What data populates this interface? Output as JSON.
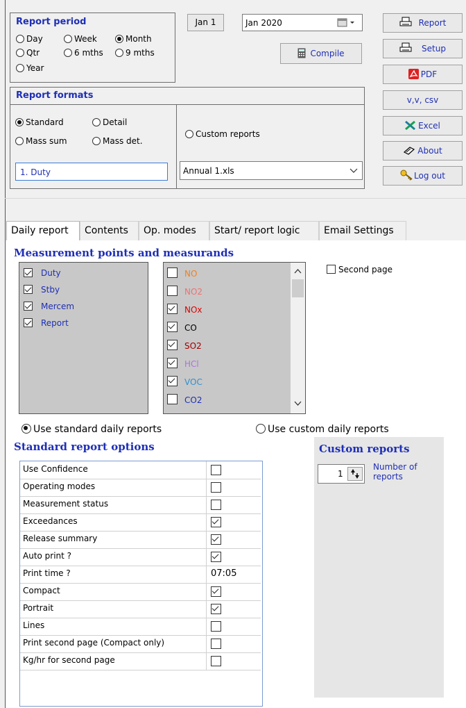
{
  "report_period": {
    "title": "Report period",
    "options": [
      {
        "label": "Day",
        "selected": false
      },
      {
        "label": "Week",
        "selected": false
      },
      {
        "label": "Month",
        "selected": true
      },
      {
        "label": "Qtr",
        "selected": false
      },
      {
        "label": "6 mths",
        "selected": false
      },
      {
        "label": "9 mths",
        "selected": false
      },
      {
        "label": "Year",
        "selected": false
      }
    ]
  },
  "date": {
    "jan1_label": "Jan 1",
    "month_value": "Jan 2020",
    "compile_label": "Compile"
  },
  "right_buttons": {
    "report": "Report",
    "setup": "Setup",
    "pdf": "PDF",
    "csv": "v,v, csv",
    "excel": "Excel",
    "about": "About",
    "logout": "Log out"
  },
  "report_formats": {
    "title": "Report formats",
    "options": [
      {
        "label": "Standard",
        "selected": true
      },
      {
        "label": "Detail",
        "selected": false
      },
      {
        "label": "Mass sum",
        "selected": false
      },
      {
        "label": "Mass det.",
        "selected": false
      }
    ],
    "custom_reports_label": "Custom reports",
    "duty_value": "1. Duty",
    "custom_file": "Annual 1.xls"
  },
  "tabs": [
    {
      "label": "Daily report",
      "active": true
    },
    {
      "label": "Contents",
      "active": false
    },
    {
      "label": "Op. modes",
      "active": false
    },
    {
      "label": "Start/ report logic",
      "active": false
    },
    {
      "label": "Email Settings",
      "active": false
    }
  ],
  "measurement": {
    "title": "Measurement points and measurands",
    "points": [
      {
        "label": "Duty",
        "checked": true
      },
      {
        "label": "Stby",
        "checked": true
      },
      {
        "label": "Mercem",
        "checked": true
      },
      {
        "label": "Report",
        "checked": true
      }
    ],
    "measurands": [
      {
        "label": "NO",
        "checked": false,
        "color": "#f08020"
      },
      {
        "label": "NO2",
        "checked": false,
        "color": "#f07070"
      },
      {
        "label": "NOx",
        "checked": true,
        "color": "#e00000"
      },
      {
        "label": "CO",
        "checked": true,
        "color": "#000000"
      },
      {
        "label": "SO2",
        "checked": true,
        "color": "#a00000"
      },
      {
        "label": "HCl",
        "checked": true,
        "color": "#b070e0"
      },
      {
        "label": "VOC",
        "checked": true,
        "color": "#3090d0"
      },
      {
        "label": "CO2",
        "checked": false,
        "color": "#1f2fb5"
      }
    ],
    "second_page_label": "Second page"
  },
  "daily_mode": {
    "standard_label": "Use standard daily reports",
    "custom_label": "Use custom daily reports",
    "standard_selected": true
  },
  "standard_options": {
    "title": "Standard report options",
    "rows": [
      {
        "label": "Use Confidence",
        "type": "check",
        "checked": false
      },
      {
        "label": "Operating modes",
        "type": "check",
        "checked": false
      },
      {
        "label": "Measurement status",
        "type": "check",
        "checked": false
      },
      {
        "label": "Exceedances",
        "type": "check",
        "checked": true
      },
      {
        "label": "Release summary",
        "type": "check",
        "checked": true
      },
      {
        "label": "Auto print ?",
        "type": "check",
        "checked": true
      },
      {
        "label": "Print time ?",
        "type": "text",
        "value": "07:05"
      },
      {
        "label": "Compact",
        "type": "check",
        "checked": true
      },
      {
        "label": "Portrait",
        "type": "check",
        "checked": true
      },
      {
        "label": "Lines",
        "type": "check",
        "checked": false
      },
      {
        "label": "Print second page (Compact only)",
        "type": "check",
        "checked": false
      },
      {
        "label": "Kg/hr for second page",
        "type": "check",
        "checked": false
      }
    ]
  },
  "custom_reports": {
    "title": "Custom reports",
    "count": "1",
    "count_label_line1": "Number of",
    "count_label_line2": "reports"
  }
}
